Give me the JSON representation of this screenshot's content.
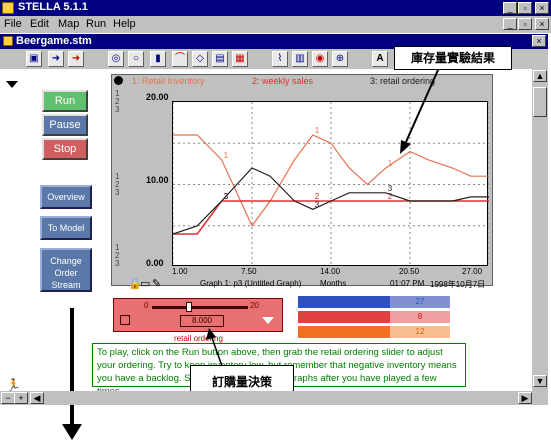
{
  "app": {
    "title": "STELLA 5.1.1"
  },
  "menu": {
    "items": [
      "File",
      "Edit",
      "Map",
      "Run",
      "Help"
    ]
  },
  "document": {
    "title": "Beergame.stm"
  },
  "controls": {
    "run_label": "Run",
    "pause_label": "Pause",
    "stop_label": "Stop",
    "overview_label": "Overview",
    "to_model_label": "To Model",
    "change_order_label": "Change Order Stream"
  },
  "graph": {
    "legend": [
      "1: Retail Inventory",
      "2: weekly sales",
      "3: retail ordering"
    ],
    "y_top_label": "20.00",
    "y_mid_label": "10.00",
    "y_bot_label": "0.00",
    "footer_title": "Graph 1: p3 (Untitled Graph)",
    "footer_units": "Months",
    "footer_time": "01:07 PM",
    "footer_date": "1998年10月7日"
  },
  "chart_data": {
    "type": "line",
    "x": [
      1,
      3,
      5,
      7.5,
      9,
      11,
      12.5,
      14,
      15.5,
      17,
      18.5,
      20.5,
      22,
      24,
      25.5,
      27
    ],
    "series": [
      {
        "name": "Retail Inventory",
        "values": [
          16,
          16,
          13,
          5,
          8,
          13,
          16,
          15,
          12,
          10,
          12,
          14,
          13,
          12,
          11,
          11
        ]
      },
      {
        "name": "weekly sales",
        "values": [
          4,
          4,
          8,
          8,
          8,
          8,
          8,
          8,
          8,
          8,
          8,
          8,
          8,
          8,
          8,
          8
        ]
      },
      {
        "name": "retail ordering",
        "values": [
          4,
          5,
          8,
          12,
          11,
          8,
          7,
          8,
          9,
          9,
          9,
          8,
          8,
          8,
          8.5,
          8.5
        ]
      }
    ],
    "xticks": [
      "1.00",
      "7.50",
      "14.00",
      "20.50",
      "27.00"
    ],
    "ylim": [
      0,
      20
    ],
    "xlim": [
      1,
      27
    ],
    "colors": {
      "inventory": "#e87050",
      "sales": "#e03030",
      "ordering": "#202020"
    }
  },
  "slider": {
    "title": "retail ordering",
    "min_label": "0",
    "max_label": "20",
    "value": "8.000"
  },
  "table": {
    "rows": [
      {
        "color": "#3050c0",
        "value": "27"
      },
      {
        "color": "#e04040",
        "value": "8"
      },
      {
        "color": "#f07020",
        "value": "12"
      }
    ]
  },
  "info": {
    "text": "To play, click on the Run button above, then grab the retail ordering slider to adjust your ordering. Try to keep inventory low, but remember that negative inventory means you have a backlog. Scroll down to see more graphs after you have played a few times."
  },
  "callouts": {
    "results": "庫存量實驗結果",
    "decision": "訂購量決策"
  }
}
